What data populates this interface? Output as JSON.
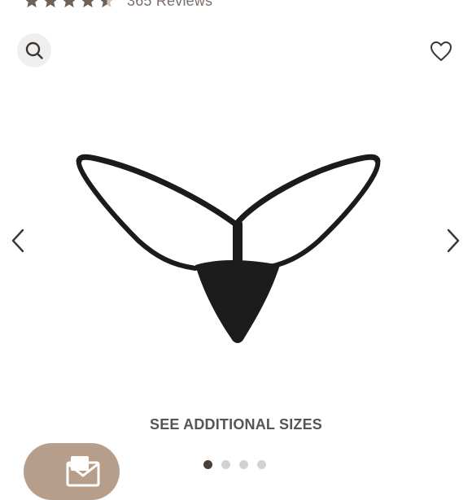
{
  "rating": {
    "value": 4.5,
    "max": 5,
    "reviews_label": "365 Reviews",
    "star_color": "#6f6259"
  },
  "toolbar": {
    "search_icon": "search-icon",
    "wishlist_icon": "heart-outline-icon"
  },
  "gallery": {
    "prev_icon": "chevron-left-icon",
    "next_icon": "chevron-right-icon",
    "total_images": 4,
    "current_image": 1
  },
  "actions": {
    "see_sizes_label": "SEE ADDITIONAL SIZES"
  },
  "mail_button": {
    "icon": "mail-icon",
    "color": "#b79e8b"
  }
}
